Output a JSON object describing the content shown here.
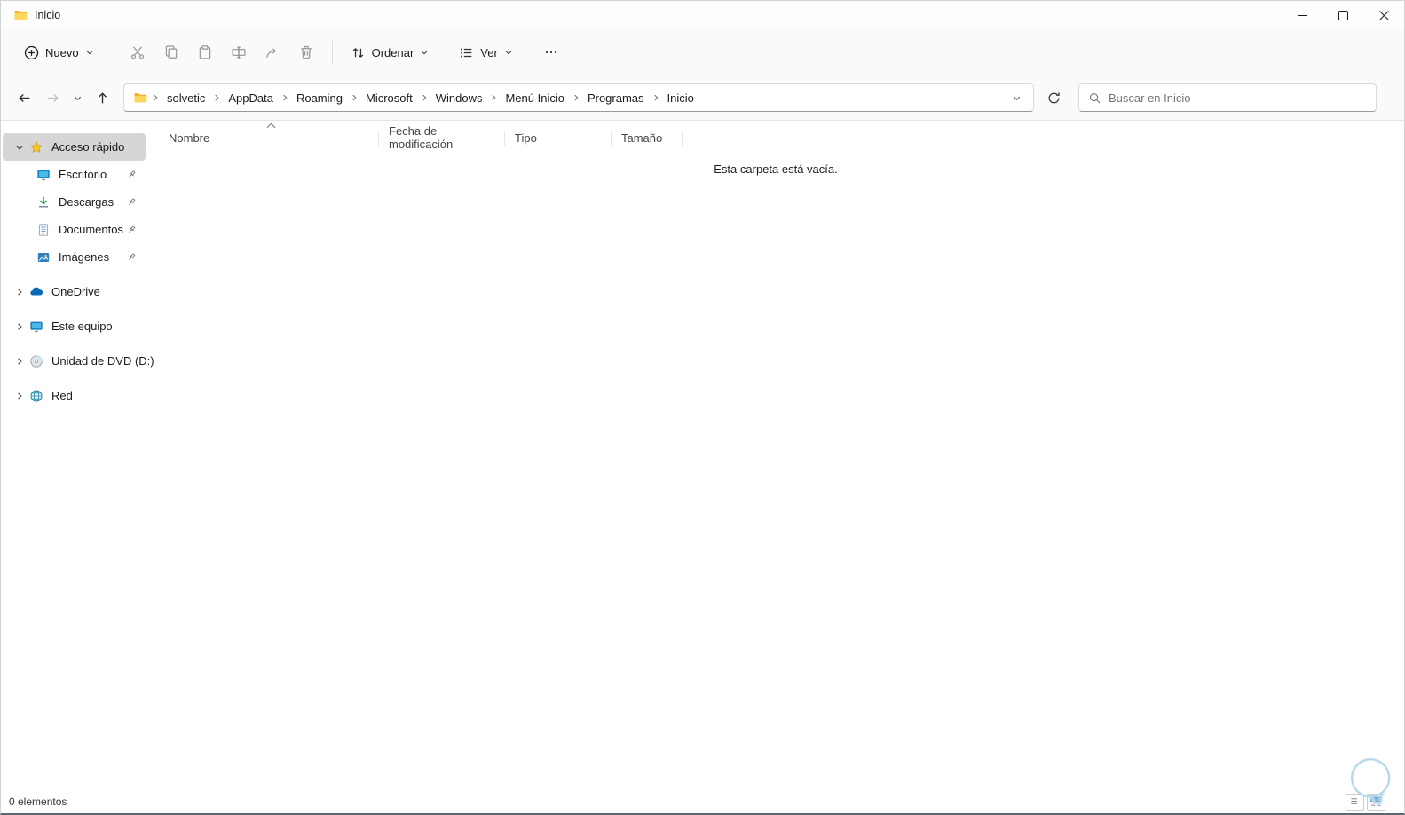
{
  "window": {
    "title": "Inicio"
  },
  "toolbar": {
    "new_label": "Nuevo",
    "sort_label": "Ordenar",
    "view_label": "Ver"
  },
  "navbar": {
    "breadcrumb": [
      "solvetic",
      "AppData",
      "Roaming",
      "Microsoft",
      "Windows",
      "Menú Inicio",
      "Programas",
      "Inicio"
    ],
    "search_placeholder": "Buscar en Inicio"
  },
  "sidebar": {
    "quick_access": {
      "label": "Acceso rápido",
      "items": [
        {
          "label": "Escritorio",
          "pinned": true
        },
        {
          "label": "Descargas",
          "pinned": true
        },
        {
          "label": "Documentos",
          "pinned": true
        },
        {
          "label": "Imágenes",
          "pinned": true
        }
      ]
    },
    "tree_items": [
      {
        "label": "OneDrive"
      },
      {
        "label": "Este equipo"
      },
      {
        "label": "Unidad de DVD (D:)"
      },
      {
        "label": "Red"
      }
    ]
  },
  "main": {
    "columns": [
      "Nombre",
      "Fecha de modificación",
      "Tipo",
      "Tamaño"
    ],
    "empty_message": "Esta carpeta está vacía."
  },
  "statusbar": {
    "items_count": "0 elementos"
  },
  "colors": {
    "accent": "#0078d4",
    "folder_yellow": "#ffd75e",
    "selection_gray": "#d6d6d6",
    "watermark_blue": "#b5d9ea"
  }
}
